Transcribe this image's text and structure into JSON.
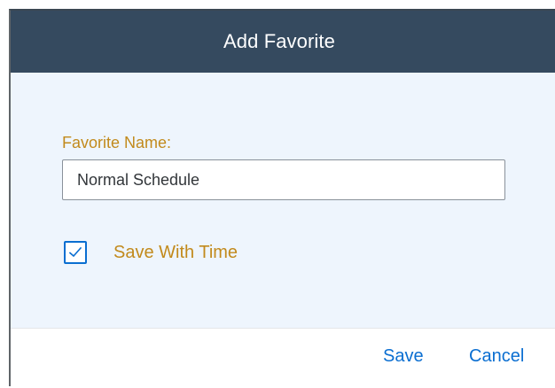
{
  "dialog": {
    "title": "Add Favorite",
    "favorite_name_label": "Favorite Name:",
    "favorite_name_value": "Normal Schedule",
    "save_with_time": {
      "label": "Save With Time",
      "checked": true
    },
    "buttons": {
      "save": "Save",
      "cancel": "Cancel"
    }
  },
  "colors": {
    "header_bg": "#354a5f",
    "content_bg": "#eef5fd",
    "label_color": "#c28a1c",
    "accent": "#0a6ed1"
  },
  "icons": {
    "checkbox_check": "checkmark-icon"
  }
}
